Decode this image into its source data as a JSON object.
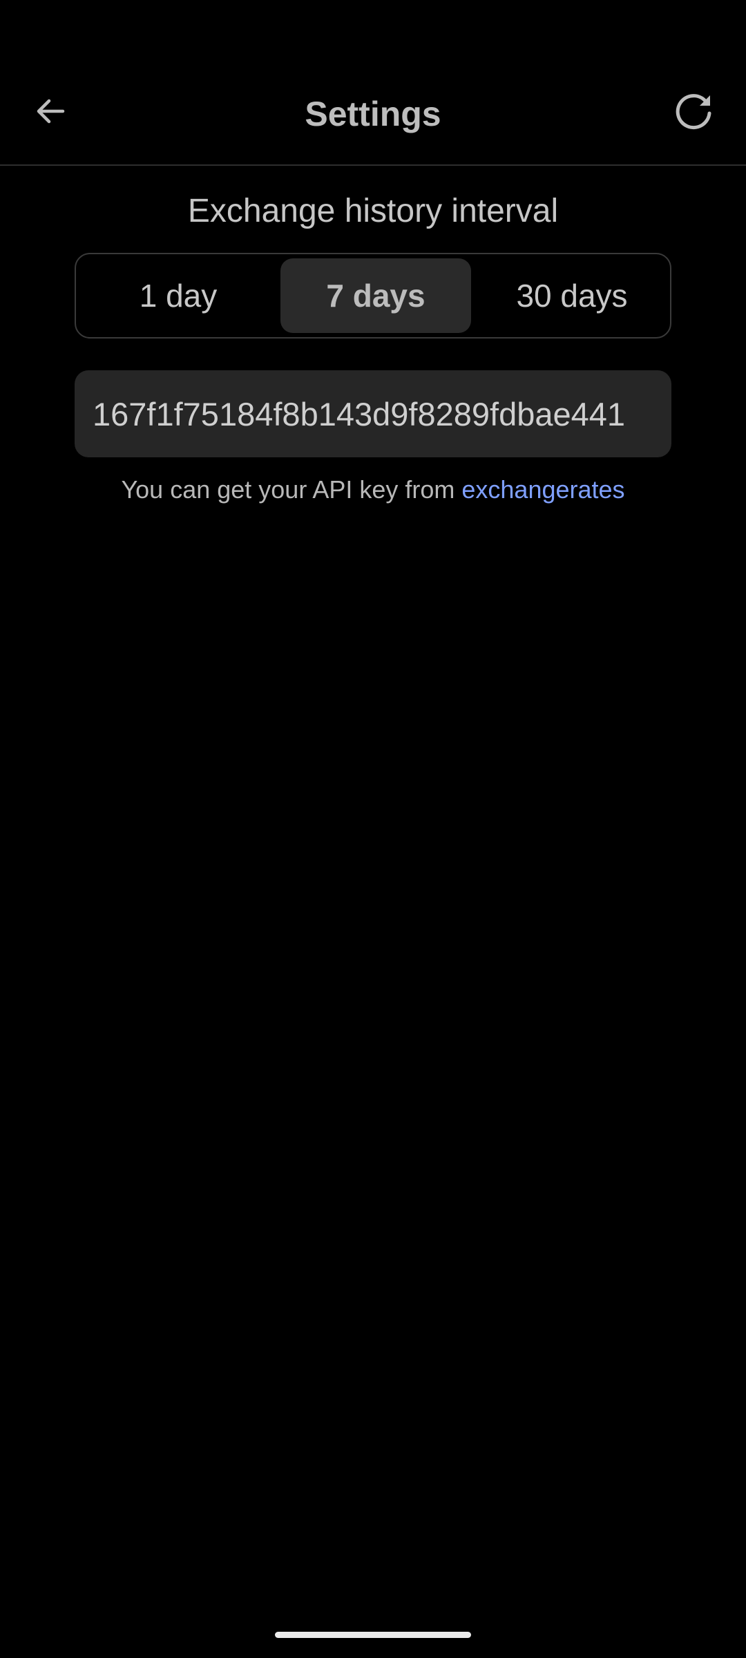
{
  "app_bar": {
    "title": "Settings",
    "back_icon": "arrow-back-icon",
    "refresh_icon": "refresh-icon"
  },
  "history_interval": {
    "label": "Exchange history interval",
    "options": [
      "1 day",
      "7 days",
      "30 days"
    ],
    "selected": "7 days"
  },
  "api_key": {
    "value": "167f1f75184f8b143d9f8289fdbae441"
  },
  "helper": {
    "text": "You can get your API key from ",
    "link_text": "exchangerates"
  },
  "colors": {
    "background": "#000000",
    "link": "#7fa0ff",
    "field_background": "#262626",
    "selected_segment": "#2a2a2a"
  }
}
